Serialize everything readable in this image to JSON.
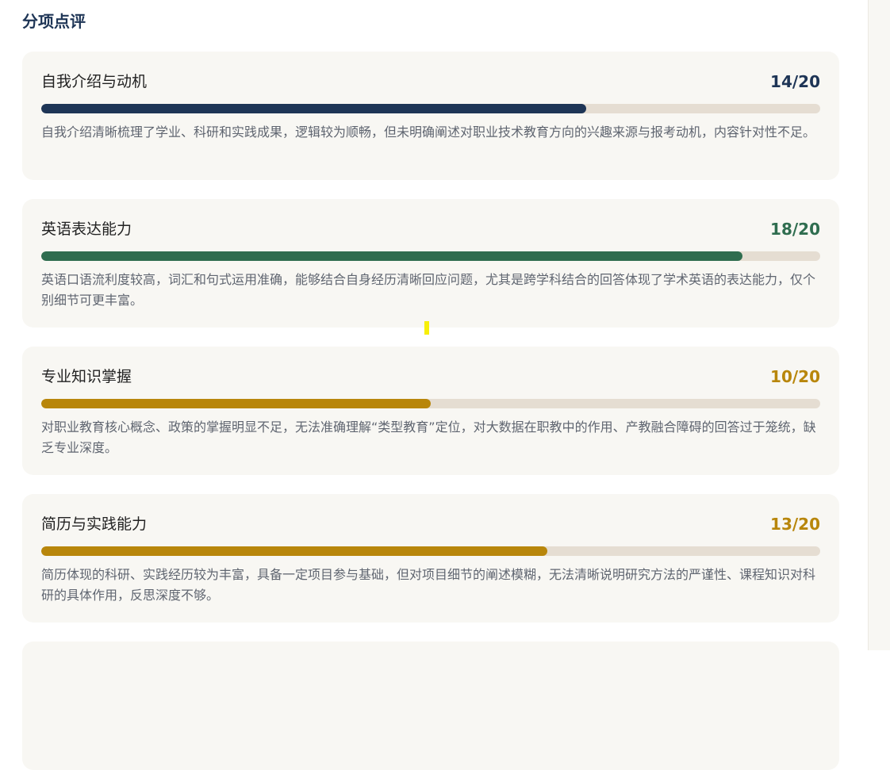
{
  "section": {
    "title": "分项点评"
  },
  "cards": [
    {
      "title": "自我介绍与动机",
      "score": "14/20",
      "value": 14,
      "max": 20,
      "color": "#1e3556",
      "comment": "自我介绍清晰梳理了学业、科研和实践成果，逻辑较为顺畅，但未明确阐述对职业技术教育方向的兴趣来源与报考动机，内容针对性不足。"
    },
    {
      "title": "英语表达能力",
      "score": "18/20",
      "value": 18,
      "max": 20,
      "color": "#2f6d4f",
      "comment": "英语口语流利度较高，词汇和句式运用准确，能够结合自身经历清晰回应问题，尤其是跨学科结合的回答体现了学术英语的表达能力，仅个别细节可更丰富。"
    },
    {
      "title": "专业知识掌握",
      "score": "10/20",
      "value": 10,
      "max": 20,
      "color": "#b8860b",
      "comment": "对职业教育核心概念、政策的掌握明显不足，无法准确理解“类型教育”定位，对大数据在职教中的作用、产教融合障碍的回答过于笼统，缺乏专业深度。"
    },
    {
      "title": "简历与实践能力",
      "score": "13/20",
      "value": 13,
      "max": 20,
      "color": "#b8860b",
      "comment": "简历体现的科研、实践经历较为丰富，具备一定项目参与基础，但对项目细节的阐述模糊，无法清晰说明研究方法的严谨性、课程知识对科研的具体作用，反思深度不够。"
    }
  ]
}
